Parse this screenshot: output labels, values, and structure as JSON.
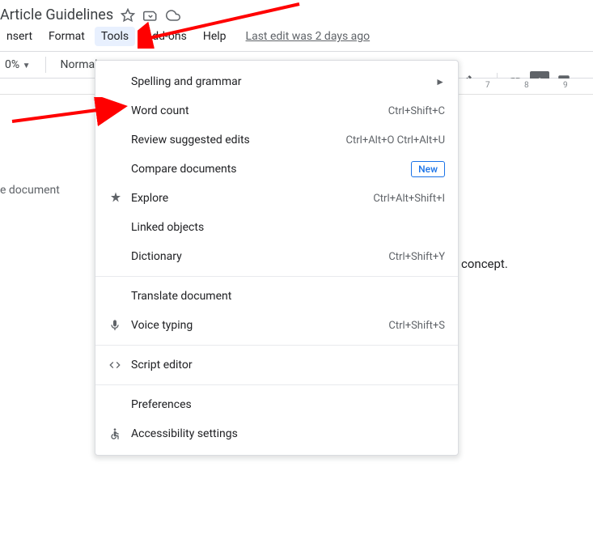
{
  "title": "Article Guidelines",
  "menubar": {
    "items": [
      "nsert",
      "Format",
      "Tools",
      "Add-ons",
      "Help"
    ],
    "active_index": 2,
    "last_edit": "Last edit was 2 days ago"
  },
  "toolbar": {
    "zoom": "0%",
    "style": "Normal"
  },
  "outline": {
    "label": "e document"
  },
  "document": {
    "snippet": "concept."
  },
  "ruler": {
    "ticks": [
      "7",
      "8",
      "9"
    ]
  },
  "dropdown": {
    "items": [
      {
        "label": "Spelling and grammar",
        "icon": "",
        "shortcut": "",
        "submenu": true
      },
      {
        "label": "Word count",
        "icon": "",
        "shortcut": "Ctrl+Shift+C"
      },
      {
        "label": "Review suggested edits",
        "icon": "",
        "shortcut": "Ctrl+Alt+O Ctrl+Alt+U"
      },
      {
        "label": "Compare documents",
        "icon": "",
        "new": true
      },
      {
        "label": "Explore",
        "icon": "explore",
        "shortcut": "Ctrl+Alt+Shift+I"
      },
      {
        "label": "Linked objects",
        "icon": ""
      },
      {
        "label": "Dictionary",
        "icon": "",
        "shortcut": "Ctrl+Shift+Y"
      },
      {
        "sep": true
      },
      {
        "label": "Translate document",
        "icon": ""
      },
      {
        "label": "Voice typing",
        "icon": "mic",
        "shortcut": "Ctrl+Shift+S"
      },
      {
        "sep": true
      },
      {
        "label": "Script editor",
        "icon": "code"
      },
      {
        "sep": true
      },
      {
        "label": "Preferences",
        "icon": ""
      },
      {
        "label": "Accessibility settings",
        "icon": "accessibility"
      }
    ],
    "new_badge": "New"
  }
}
